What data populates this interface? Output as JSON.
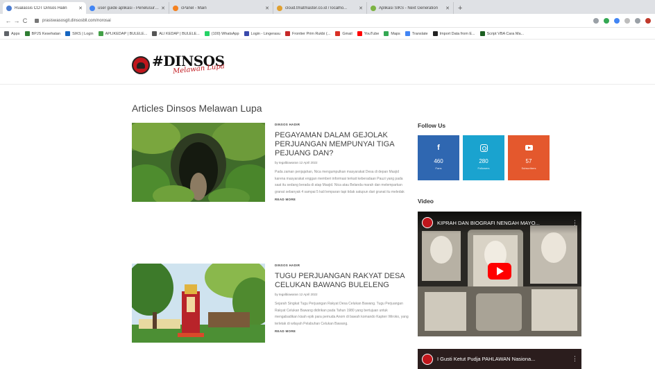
{
  "browser": {
    "tabs": [
      {
        "title": "Rualassis COT Dinsos Halin",
        "active": true,
        "color": "#4a7bd0"
      },
      {
        "title": "user guide aplikasi - Penelusuran",
        "active": false,
        "color": "#4285f4"
      },
      {
        "title": "cPanel - Main",
        "active": false,
        "color": "#f4811f"
      },
      {
        "title": "cloud.tmatmaster.co.id / localho...",
        "active": false,
        "color": "#e0a030"
      },
      {
        "title": "Aplikasi SIKS - Next Generation",
        "active": false,
        "color": "#7cb342"
      }
    ],
    "new_tab": "+",
    "url": "prasiswasosgit.dinsosbll.com/norosai",
    "nav": {
      "back": "←",
      "forward": "→",
      "reload": "C"
    },
    "bookmarks": [
      {
        "label": "Apps",
        "color": "#5f6368"
      },
      {
        "label": "BPJS Kesehatan",
        "color": "#2e7d32"
      },
      {
        "label": "SIKS | Login",
        "color": "#1565c0"
      },
      {
        "label": "APLIKEDAP | BULELE...",
        "color": "#43a047"
      },
      {
        "label": "ALI KEDAP | BULELE...",
        "color": "#555555"
      },
      {
        "label": "(100) WhatsApp",
        "color": "#25d366"
      },
      {
        "label": "Login - Lingerasu",
        "color": "#3949ab"
      },
      {
        "label": "Frontier Prim Rukbi (...",
        "color": "#c62828"
      },
      {
        "label": "Gmail",
        "color": "#d93025"
      },
      {
        "label": "YouTube",
        "color": "#ff0000"
      },
      {
        "label": "Maps",
        "color": "#34a853"
      },
      {
        "label": "Translate",
        "color": "#4285f4"
      },
      {
        "label": "Import Data from E...",
        "color": "#222222"
      },
      {
        "label": "Script VBA Cara Ma...",
        "color": "#1b5e20"
      }
    ]
  },
  "site": {
    "logo_main": "#DINSOS",
    "logo_sub": "Melawan Lupa"
  },
  "main": {
    "section_title": "Articles Dinsos Melawan Lupa",
    "articles": [
      {
        "category": "DINSOS HADIR",
        "title": "PEGAYAMAN DALAM GEJOLAK PERJUANGAN MEMPUNYAI TIGA PEJUANG DAN?",
        "byline": "by tegalbiawaran 12 April 2022",
        "excerpt": "Pada zaman penjajahan, Nica mengumpulkan masyarakat Desa di depan Masjid karena masyarakat enggan memberi informasi terkait keberadaan Pauzi yang pada saat itu sedang berada di atap Masjid. Nica atau Belanda marah dan melemparkan granat sebanyak 4 sampai 5 kali lemparan tapi tidak satupun dari granat itu meledak",
        "read_more": "READ MORE"
      },
      {
        "category": "DINSOS HADIR",
        "title": "TUGU PERJUANGAN RAKYAT DESA CELUKAN BAWANG BULELENG",
        "byline": "by tegalbiawaran 12 April 2022",
        "excerpt": "Sejarah Singkat Tugu Perjuangan Rakyat Desa Celukan Bawang. Tugu Perjuangan Rakyat Celukan Bawang didirikan pada Tahun 1980 yang bertujuan untuk mengabadikan kisah epik para pemuda Anom di bawah komando Kapten Wiroko, yang terletak di wilayah Pelabuhan Celukan Bawang.",
        "read_more": "READ MORE"
      }
    ]
  },
  "sidebar": {
    "follow_title": "Follow Us",
    "follow": [
      {
        "network": "facebook",
        "icon": "f",
        "count": "460",
        "label": "Fans",
        "color": "#2f67b1"
      },
      {
        "network": "instagram",
        "icon": "instagram-icon",
        "count": "280",
        "label": "Followers",
        "color": "#1aa3cf"
      },
      {
        "network": "youtube",
        "icon": "youtube-icon",
        "count": "57",
        "label": "Subscribers",
        "color": "#e4582d"
      }
    ],
    "video_title": "Video",
    "videos": [
      {
        "title": "KIPRAH DAN BIOGRAFI NENGAH MAYO..."
      },
      {
        "title": "I Gusti Ketut Pudja PAHLAWAN Nasiona..."
      }
    ]
  }
}
